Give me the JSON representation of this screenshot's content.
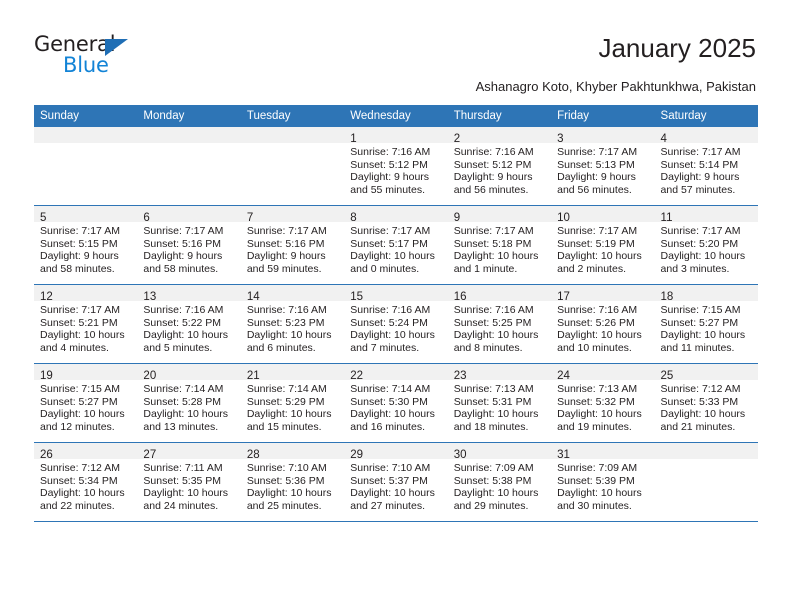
{
  "brand": {
    "name_top": "General",
    "name_bottom": "Blue",
    "triangle_color": "#1f6eb5",
    "blue_color": "#1283d6"
  },
  "header": {
    "title": "January 2025",
    "location": "Ashanagro Koto, Khyber Pakhtunkhwa, Pakistan",
    "header_bg": "#2e75b6",
    "daynum_bg": "#f1f1f1"
  },
  "weekdays": [
    "Sunday",
    "Monday",
    "Tuesday",
    "Wednesday",
    "Thursday",
    "Friday",
    "Saturday"
  ],
  "weeks": [
    [
      {
        "day": "",
        "empty": true
      },
      {
        "day": "",
        "empty": true
      },
      {
        "day": "",
        "empty": true
      },
      {
        "day": "1",
        "sunrise": "Sunrise: 7:16 AM",
        "sunset": "Sunset: 5:12 PM",
        "daylight1": "Daylight: 9 hours",
        "daylight2": "and 55 minutes."
      },
      {
        "day": "2",
        "sunrise": "Sunrise: 7:16 AM",
        "sunset": "Sunset: 5:12 PM",
        "daylight1": "Daylight: 9 hours",
        "daylight2": "and 56 minutes."
      },
      {
        "day": "3",
        "sunrise": "Sunrise: 7:17 AM",
        "sunset": "Sunset: 5:13 PM",
        "daylight1": "Daylight: 9 hours",
        "daylight2": "and 56 minutes."
      },
      {
        "day": "4",
        "sunrise": "Sunrise: 7:17 AM",
        "sunset": "Sunset: 5:14 PM",
        "daylight1": "Daylight: 9 hours",
        "daylight2": "and 57 minutes."
      }
    ],
    [
      {
        "day": "5",
        "sunrise": "Sunrise: 7:17 AM",
        "sunset": "Sunset: 5:15 PM",
        "daylight1": "Daylight: 9 hours",
        "daylight2": "and 58 minutes."
      },
      {
        "day": "6",
        "sunrise": "Sunrise: 7:17 AM",
        "sunset": "Sunset: 5:16 PM",
        "daylight1": "Daylight: 9 hours",
        "daylight2": "and 58 minutes."
      },
      {
        "day": "7",
        "sunrise": "Sunrise: 7:17 AM",
        "sunset": "Sunset: 5:16 PM",
        "daylight1": "Daylight: 9 hours",
        "daylight2": "and 59 minutes."
      },
      {
        "day": "8",
        "sunrise": "Sunrise: 7:17 AM",
        "sunset": "Sunset: 5:17 PM",
        "daylight1": "Daylight: 10 hours",
        "daylight2": "and 0 minutes."
      },
      {
        "day": "9",
        "sunrise": "Sunrise: 7:17 AM",
        "sunset": "Sunset: 5:18 PM",
        "daylight1": "Daylight: 10 hours",
        "daylight2": "and 1 minute."
      },
      {
        "day": "10",
        "sunrise": "Sunrise: 7:17 AM",
        "sunset": "Sunset: 5:19 PM",
        "daylight1": "Daylight: 10 hours",
        "daylight2": "and 2 minutes."
      },
      {
        "day": "11",
        "sunrise": "Sunrise: 7:17 AM",
        "sunset": "Sunset: 5:20 PM",
        "daylight1": "Daylight: 10 hours",
        "daylight2": "and 3 minutes."
      }
    ],
    [
      {
        "day": "12",
        "sunrise": "Sunrise: 7:17 AM",
        "sunset": "Sunset: 5:21 PM",
        "daylight1": "Daylight: 10 hours",
        "daylight2": "and 4 minutes."
      },
      {
        "day": "13",
        "sunrise": "Sunrise: 7:16 AM",
        "sunset": "Sunset: 5:22 PM",
        "daylight1": "Daylight: 10 hours",
        "daylight2": "and 5 minutes."
      },
      {
        "day": "14",
        "sunrise": "Sunrise: 7:16 AM",
        "sunset": "Sunset: 5:23 PM",
        "daylight1": "Daylight: 10 hours",
        "daylight2": "and 6 minutes."
      },
      {
        "day": "15",
        "sunrise": "Sunrise: 7:16 AM",
        "sunset": "Sunset: 5:24 PM",
        "daylight1": "Daylight: 10 hours",
        "daylight2": "and 7 minutes."
      },
      {
        "day": "16",
        "sunrise": "Sunrise: 7:16 AM",
        "sunset": "Sunset: 5:25 PM",
        "daylight1": "Daylight: 10 hours",
        "daylight2": "and 8 minutes."
      },
      {
        "day": "17",
        "sunrise": "Sunrise: 7:16 AM",
        "sunset": "Sunset: 5:26 PM",
        "daylight1": "Daylight: 10 hours",
        "daylight2": "and 10 minutes."
      },
      {
        "day": "18",
        "sunrise": "Sunrise: 7:15 AM",
        "sunset": "Sunset: 5:27 PM",
        "daylight1": "Daylight: 10 hours",
        "daylight2": "and 11 minutes."
      }
    ],
    [
      {
        "day": "19",
        "sunrise": "Sunrise: 7:15 AM",
        "sunset": "Sunset: 5:27 PM",
        "daylight1": "Daylight: 10 hours",
        "daylight2": "and 12 minutes."
      },
      {
        "day": "20",
        "sunrise": "Sunrise: 7:14 AM",
        "sunset": "Sunset: 5:28 PM",
        "daylight1": "Daylight: 10 hours",
        "daylight2": "and 13 minutes."
      },
      {
        "day": "21",
        "sunrise": "Sunrise: 7:14 AM",
        "sunset": "Sunset: 5:29 PM",
        "daylight1": "Daylight: 10 hours",
        "daylight2": "and 15 minutes."
      },
      {
        "day": "22",
        "sunrise": "Sunrise: 7:14 AM",
        "sunset": "Sunset: 5:30 PM",
        "daylight1": "Daylight: 10 hours",
        "daylight2": "and 16 minutes."
      },
      {
        "day": "23",
        "sunrise": "Sunrise: 7:13 AM",
        "sunset": "Sunset: 5:31 PM",
        "daylight1": "Daylight: 10 hours",
        "daylight2": "and 18 minutes."
      },
      {
        "day": "24",
        "sunrise": "Sunrise: 7:13 AM",
        "sunset": "Sunset: 5:32 PM",
        "daylight1": "Daylight: 10 hours",
        "daylight2": "and 19 minutes."
      },
      {
        "day": "25",
        "sunrise": "Sunrise: 7:12 AM",
        "sunset": "Sunset: 5:33 PM",
        "daylight1": "Daylight: 10 hours",
        "daylight2": "and 21 minutes."
      }
    ],
    [
      {
        "day": "26",
        "sunrise": "Sunrise: 7:12 AM",
        "sunset": "Sunset: 5:34 PM",
        "daylight1": "Daylight: 10 hours",
        "daylight2": "and 22 minutes."
      },
      {
        "day": "27",
        "sunrise": "Sunrise: 7:11 AM",
        "sunset": "Sunset: 5:35 PM",
        "daylight1": "Daylight: 10 hours",
        "daylight2": "and 24 minutes."
      },
      {
        "day": "28",
        "sunrise": "Sunrise: 7:10 AM",
        "sunset": "Sunset: 5:36 PM",
        "daylight1": "Daylight: 10 hours",
        "daylight2": "and 25 minutes."
      },
      {
        "day": "29",
        "sunrise": "Sunrise: 7:10 AM",
        "sunset": "Sunset: 5:37 PM",
        "daylight1": "Daylight: 10 hours",
        "daylight2": "and 27 minutes."
      },
      {
        "day": "30",
        "sunrise": "Sunrise: 7:09 AM",
        "sunset": "Sunset: 5:38 PM",
        "daylight1": "Daylight: 10 hours",
        "daylight2": "and 29 minutes."
      },
      {
        "day": "31",
        "sunrise": "Sunrise: 7:09 AM",
        "sunset": "Sunset: 5:39 PM",
        "daylight1": "Daylight: 10 hours",
        "daylight2": "and 30 minutes."
      },
      {
        "day": "",
        "empty": true
      }
    ]
  ]
}
